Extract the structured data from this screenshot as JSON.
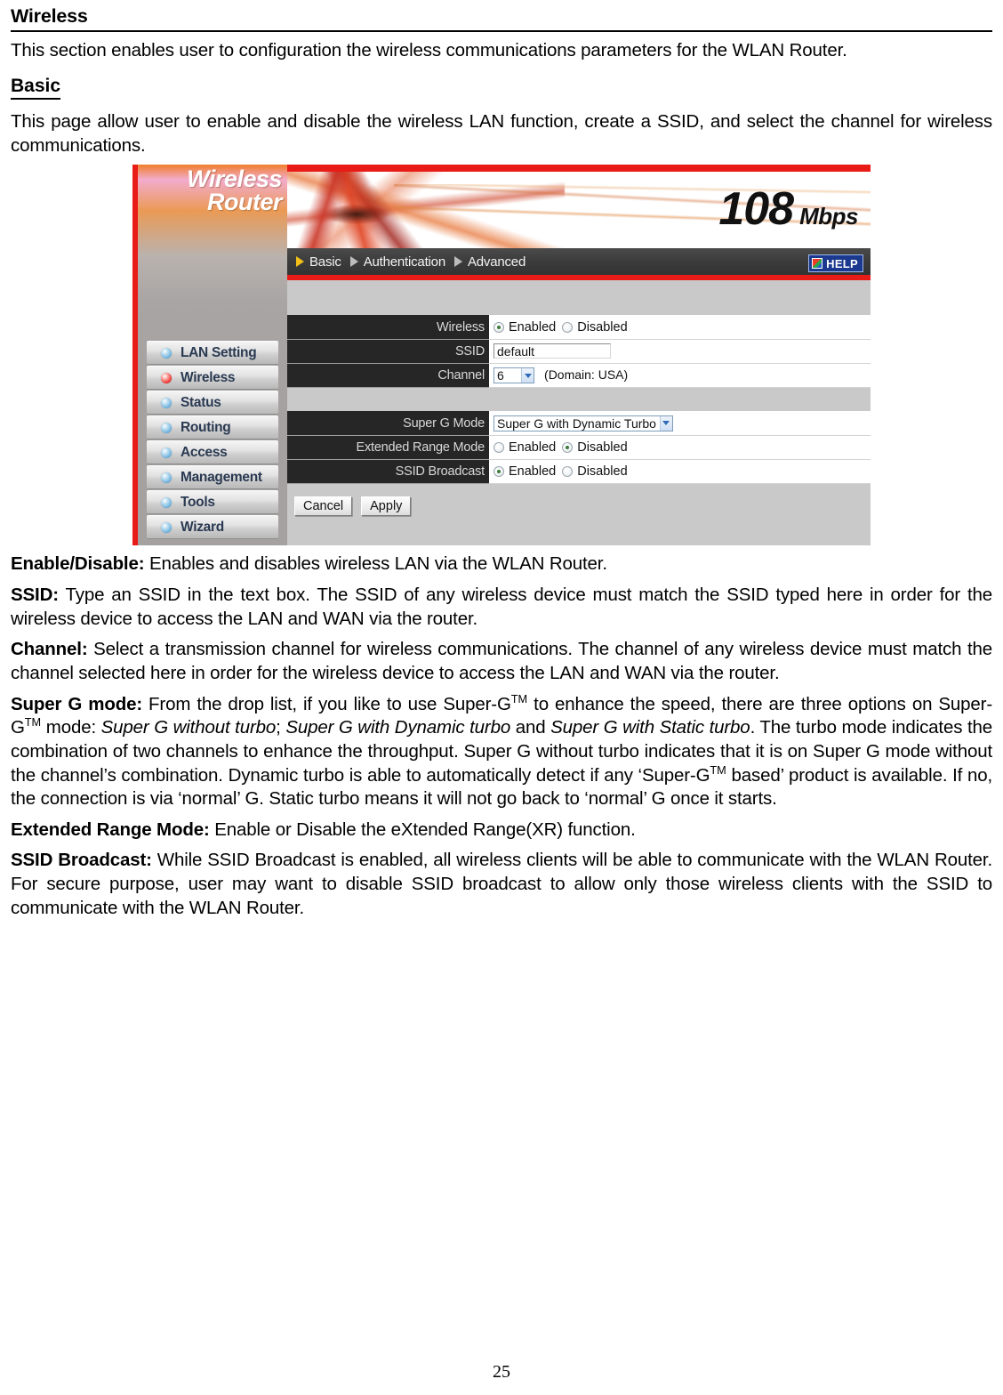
{
  "document": {
    "heading": "Wireless",
    "intro": "This section enables user to configuration the wireless communications parameters for the WLAN Router.",
    "subheading": "Basic",
    "subintro": "This page allow user to enable and disable the wireless LAN function, create a SSID, and select the channel for wireless communications.",
    "page_number": "25"
  },
  "definitions": {
    "enable_disable": {
      "term": "Enable/Disable:",
      "text": " Enables and disables wireless LAN via the WLAN Router."
    },
    "ssid": {
      "term": "SSID:",
      "text": " Type an SSID in the text box. The SSID of any wireless device must match the SSID typed here in order for the wireless device to access the LAN and WAN via the router."
    },
    "channel": {
      "term": "Channel:",
      "text": " Select a transmission channel for wireless communications. The channel of any wireless device must match the channel selected here in order for the wireless device to access the LAN and WAN via the router."
    },
    "super_g": {
      "term": "Super G mode:",
      "seg1": " From the drop list, if you like to use Super-G",
      "tm1": "TM",
      "seg2": " to enhance the speed, there are three options on Super-G",
      "tm2": "TM",
      "seg3": " mode: ",
      "opt1": "Super G without turbo",
      "sep1": "; ",
      "opt2": "Super G with Dynamic turbo",
      "sep2": " and ",
      "opt3": "Super G with Static turbo",
      "seg4": ".   The turbo mode indicates the combination of two channels to enhance the throughput.   Super G without turbo indicates that it is on Super G mode without the channel’s combination.   Dynamic turbo is able to automatically detect if any ‘Super-G",
      "tm3": "TM",
      "seg5": " based’ product is available.  If no, the connection is via ‘normal’ G. Static turbo means it will not go back to ‘normal’ G once it starts."
    },
    "extended_range": {
      "term": "Extended Range Mode:",
      "text": " Enable or Disable the eXtended Range(XR)  function."
    },
    "ssid_broadcast": {
      "term": "SSID Broadcast:",
      "text": " While SSID Broadcast is enabled, all wireless clients will be able to communicate with the WLAN Router. For secure purpose, user may want to disable SSID broadcast to allow only those wireless clients with the SSID to communicate with the WLAN Router."
    }
  },
  "router_ui": {
    "logo": {
      "line1": "Wireless",
      "line2": "Router"
    },
    "banner": {
      "speed": "108",
      "unit": "Mbps"
    },
    "navbar": {
      "crumbs": [
        {
          "label": "Basic"
        },
        {
          "label": "Authentication"
        },
        {
          "label": "Advanced"
        }
      ],
      "help_label": "HELP"
    },
    "sidebar": {
      "items": [
        {
          "label": "LAN Setting",
          "active": false
        },
        {
          "label": "Wireless",
          "active": true
        },
        {
          "label": "Status",
          "active": false
        },
        {
          "label": "Routing",
          "active": false
        },
        {
          "label": "Access",
          "active": false
        },
        {
          "label": "Management",
          "active": false
        },
        {
          "label": "Tools",
          "active": false
        },
        {
          "label": "Wizard",
          "active": false
        }
      ]
    },
    "form": {
      "wireless": {
        "label": "Wireless",
        "enabled_label": "Enabled",
        "disabled_label": "Disabled",
        "value": "Enabled"
      },
      "ssid": {
        "label": "SSID",
        "value": "default"
      },
      "channel": {
        "label": "Channel",
        "value": "6",
        "domain_note": "(Domain: USA)"
      },
      "super_g_mode": {
        "label": "Super G Mode",
        "value": "Super G with Dynamic Turbo"
      },
      "extended_range_mode": {
        "label": "Extended Range Mode",
        "enabled_label": "Enabled",
        "disabled_label": "Disabled",
        "value": "Disabled"
      },
      "ssid_broadcast": {
        "label": "SSID Broadcast",
        "enabled_label": "Enabled",
        "disabled_label": "Disabled",
        "value": "Enabled"
      },
      "buttons": {
        "cancel": "Cancel",
        "apply": "Apply"
      }
    }
  }
}
